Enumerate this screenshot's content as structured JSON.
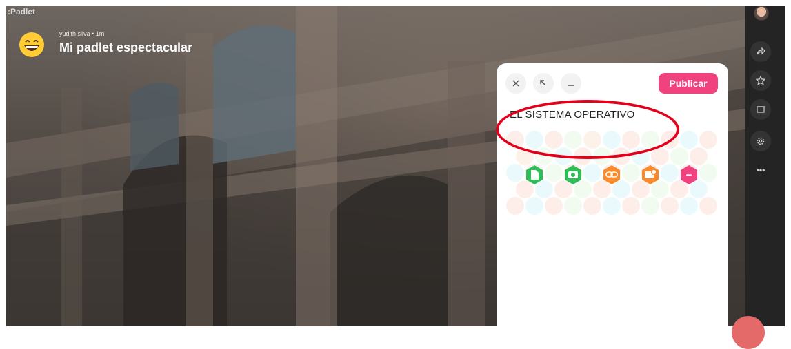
{
  "app": {
    "brand": ":Padlet"
  },
  "header": {
    "emoji": "grinning-face-emoji",
    "author": "yudith silva",
    "separator": "•",
    "time": "1m",
    "title": "Mi padlet espectacular"
  },
  "sidebar": {
    "items": [
      {
        "icon": "share-icon"
      },
      {
        "icon": "star-icon"
      },
      {
        "icon": "slideshow-icon"
      },
      {
        "icon": "settings-icon"
      },
      {
        "icon": "more-icon",
        "label": "•••"
      }
    ]
  },
  "composer": {
    "close_icon": "close-icon",
    "expand_icon": "expand-icon",
    "minimize_icon": "minimize-icon",
    "publish_label": "Publicar",
    "post_title": "EL SISTEMA OPERATIVO",
    "attachments": [
      {
        "icon": "document-upload-icon",
        "color": "#2ebd59"
      },
      {
        "icon": "camera-icon",
        "color": "#2ebd59"
      },
      {
        "icon": "link-icon",
        "color": "#f98b2c"
      },
      {
        "icon": "image-search-icon",
        "color": "#f98b2c"
      },
      {
        "icon": "more-options-icon",
        "color": "#f0427e",
        "label": "•••"
      }
    ]
  },
  "colors": {
    "accent": "#f0427e",
    "annotation": "#e3001b",
    "sidebar_bg": "#242424"
  }
}
